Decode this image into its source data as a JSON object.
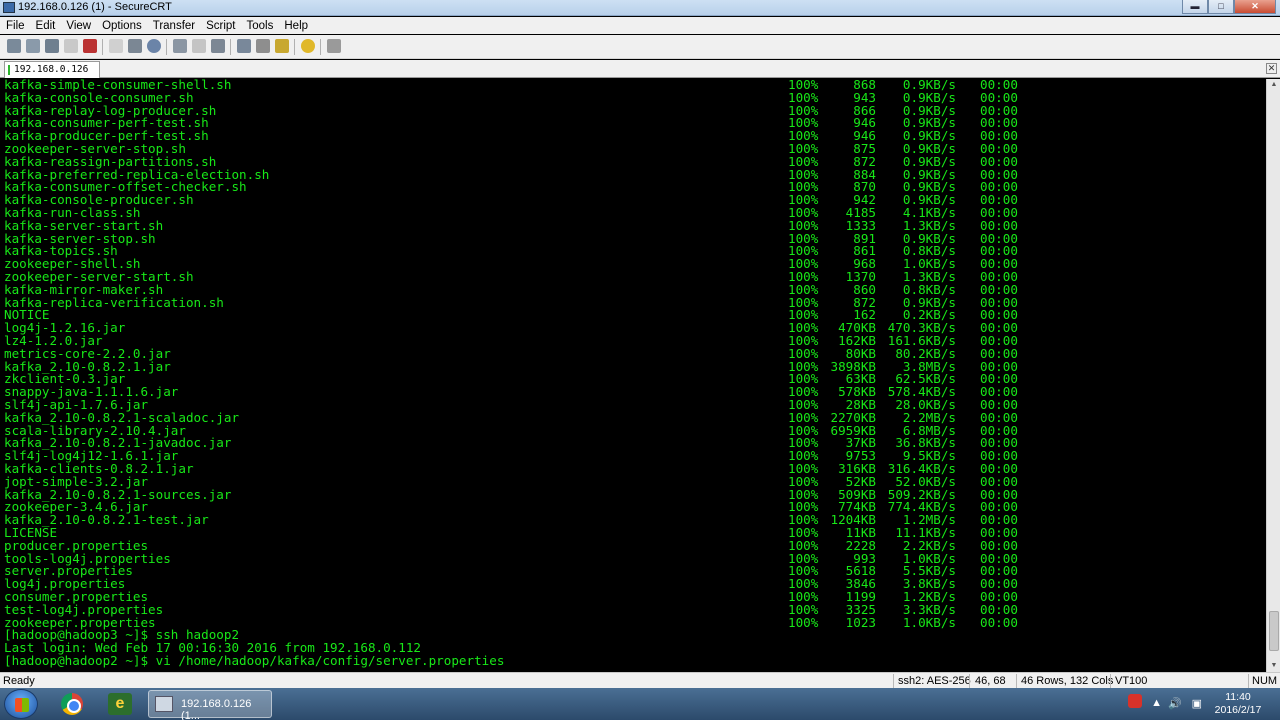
{
  "window": {
    "title": "192.168.0.126 (1) - SecureCRT"
  },
  "menu": [
    "File",
    "Edit",
    "View",
    "Options",
    "Transfer",
    "Script",
    "Tools",
    "Help"
  ],
  "tab": {
    "label": "192.168.0.126 (1)"
  },
  "transfers": [
    [
      "kafka-simple-consumer-shell.sh",
      "100%",
      "868",
      "0.9KB/s",
      "00:00"
    ],
    [
      "kafka-console-consumer.sh",
      "100%",
      "943",
      "0.9KB/s",
      "00:00"
    ],
    [
      "kafka-replay-log-producer.sh",
      "100%",
      "866",
      "0.9KB/s",
      "00:00"
    ],
    [
      "kafka-consumer-perf-test.sh",
      "100%",
      "946",
      "0.9KB/s",
      "00:00"
    ],
    [
      "kafka-producer-perf-test.sh",
      "100%",
      "946",
      "0.9KB/s",
      "00:00"
    ],
    [
      "zookeeper-server-stop.sh",
      "100%",
      "875",
      "0.9KB/s",
      "00:00"
    ],
    [
      "kafka-reassign-partitions.sh",
      "100%",
      "872",
      "0.9KB/s",
      "00:00"
    ],
    [
      "kafka-preferred-replica-election.sh",
      "100%",
      "884",
      "0.9KB/s",
      "00:00"
    ],
    [
      "kafka-consumer-offset-checker.sh",
      "100%",
      "870",
      "0.9KB/s",
      "00:00"
    ],
    [
      "kafka-console-producer.sh",
      "100%",
      "942",
      "0.9KB/s",
      "00:00"
    ],
    [
      "kafka-run-class.sh",
      "100%",
      "4185",
      "4.1KB/s",
      "00:00"
    ],
    [
      "kafka-server-start.sh",
      "100%",
      "1333",
      "1.3KB/s",
      "00:00"
    ],
    [
      "kafka-server-stop.sh",
      "100%",
      "891",
      "0.9KB/s",
      "00:00"
    ],
    [
      "kafka-topics.sh",
      "100%",
      "861",
      "0.8KB/s",
      "00:00"
    ],
    [
      "zookeeper-shell.sh",
      "100%",
      "968",
      "1.0KB/s",
      "00:00"
    ],
    [
      "zookeeper-server-start.sh",
      "100%",
      "1370",
      "1.3KB/s",
      "00:00"
    ],
    [
      "kafka-mirror-maker.sh",
      "100%",
      "860",
      "0.8KB/s",
      "00:00"
    ],
    [
      "kafka-replica-verification.sh",
      "100%",
      "872",
      "0.9KB/s",
      "00:00"
    ],
    [
      "NOTICE",
      "100%",
      "162",
      "0.2KB/s",
      "00:00"
    ],
    [
      "log4j-1.2.16.jar",
      "100%",
      "470KB",
      "470.3KB/s",
      "00:00"
    ],
    [
      "lz4-1.2.0.jar",
      "100%",
      "162KB",
      "161.6KB/s",
      "00:00"
    ],
    [
      "metrics-core-2.2.0.jar",
      "100%",
      "80KB",
      "80.2KB/s",
      "00:00"
    ],
    [
      "kafka_2.10-0.8.2.1.jar",
      "100%",
      "3898KB",
      "3.8MB/s",
      "00:00"
    ],
    [
      "zkclient-0.3.jar",
      "100%",
      "63KB",
      "62.5KB/s",
      "00:00"
    ],
    [
      "snappy-java-1.1.1.6.jar",
      "100%",
      "578KB",
      "578.4KB/s",
      "00:00"
    ],
    [
      "slf4j-api-1.7.6.jar",
      "100%",
      "28KB",
      "28.0KB/s",
      "00:00"
    ],
    [
      "kafka_2.10-0.8.2.1-scaladoc.jar",
      "100%",
      "2270KB",
      "2.2MB/s",
      "00:00"
    ],
    [
      "scala-library-2.10.4.jar",
      "100%",
      "6959KB",
      "6.8MB/s",
      "00:00"
    ],
    [
      "kafka_2.10-0.8.2.1-javadoc.jar",
      "100%",
      "37KB",
      "36.8KB/s",
      "00:00"
    ],
    [
      "slf4j-log4j12-1.6.1.jar",
      "100%",
      "9753",
      "9.5KB/s",
      "00:00"
    ],
    [
      "kafka-clients-0.8.2.1.jar",
      "100%",
      "316KB",
      "316.4KB/s",
      "00:00"
    ],
    [
      "jopt-simple-3.2.jar",
      "100%",
      "52KB",
      "52.0KB/s",
      "00:00"
    ],
    [
      "kafka_2.10-0.8.2.1-sources.jar",
      "100%",
      "509KB",
      "509.2KB/s",
      "00:00"
    ],
    [
      "zookeeper-3.4.6.jar",
      "100%",
      "774KB",
      "774.4KB/s",
      "00:00"
    ],
    [
      "kafka_2.10-0.8.2.1-test.jar",
      "100%",
      "1204KB",
      "1.2MB/s",
      "00:00"
    ],
    [
      "LICENSE",
      "100%",
      "11KB",
      "11.1KB/s",
      "00:00"
    ],
    [
      "producer.properties",
      "100%",
      "2228",
      "2.2KB/s",
      "00:00"
    ],
    [
      "tools-log4j.properties",
      "100%",
      "993",
      "1.0KB/s",
      "00:00"
    ],
    [
      "server.properties",
      "100%",
      "5618",
      "5.5KB/s",
      "00:00"
    ],
    [
      "log4j.properties",
      "100%",
      "3846",
      "3.8KB/s",
      "00:00"
    ],
    [
      "consumer.properties",
      "100%",
      "1199",
      "1.2KB/s",
      "00:00"
    ],
    [
      "test-log4j.properties",
      "100%",
      "3325",
      "3.3KB/s",
      "00:00"
    ],
    [
      "zookeeper.properties",
      "100%",
      "1023",
      "1.0KB/s",
      "00:00"
    ]
  ],
  "shell_lines": [
    "[hadoop@hadoop3 ~]$ ssh hadoop2",
    "Last login: Wed Feb 17 00:16:30 2016 from 192.168.0.112",
    "[hadoop@hadoop2 ~]$ vi /home/hadoop/kafka/config/server.properties"
  ],
  "status": {
    "ready": "Ready",
    "cipher": "ssh2: AES-256",
    "cursor": "46,  68",
    "size": "46 Rows, 132 Cols",
    "emulation": "VT100",
    "num": "NUM"
  },
  "taskbar": {
    "securecrt_label": "192.168.0.126 (1...",
    "time": "11:40",
    "date": "2016/2/17"
  },
  "colors": {
    "terminal_text": "#18e818",
    "terminal_bg": "#000000"
  }
}
